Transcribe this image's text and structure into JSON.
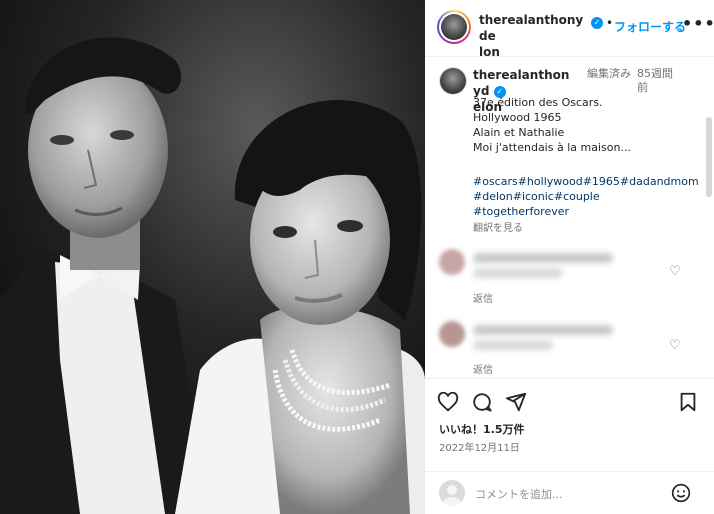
{
  "post": {
    "username": "therealanthonydelon",
    "username_line1": "therealanthonyde",
    "username_line2": "lon",
    "follow_label": "フォローする",
    "more_label": "•••",
    "verified_glyph": "✓"
  },
  "caption": {
    "username_line1": "therealanthonyd",
    "username_line2": "elon",
    "edited": "編集済み",
    "age": "85週間前",
    "lines": [
      "37e édition des Oscars.",
      "Hollywood 1965",
      "Alain et Nathalie",
      "Moi j'attendais à la maison..."
    ],
    "hashtag_lines": [
      "#oscars#hollywood#1965#dadandmom",
      "#delon#iconic#couple",
      "#togetherforever"
    ],
    "translate_label": "翻訳を見る"
  },
  "comments": [
    {
      "reply_label": "返信",
      "avatar_color": "#c9a6a6"
    },
    {
      "reply_label": "返信",
      "avatar_color": "#b89590"
    }
  ],
  "actions": {
    "likes_text": "いいね！1.5万件",
    "date_text": "2022年12月11日",
    "comment_placeholder": "コメントを追加...",
    "icons": [
      "heart-icon",
      "comment-icon",
      "share-icon",
      "bookmark-icon",
      "emoji-icon"
    ]
  },
  "colors": {
    "accent": "#0095f6",
    "hashtag": "#00376b",
    "secondary_text": "#737373"
  }
}
